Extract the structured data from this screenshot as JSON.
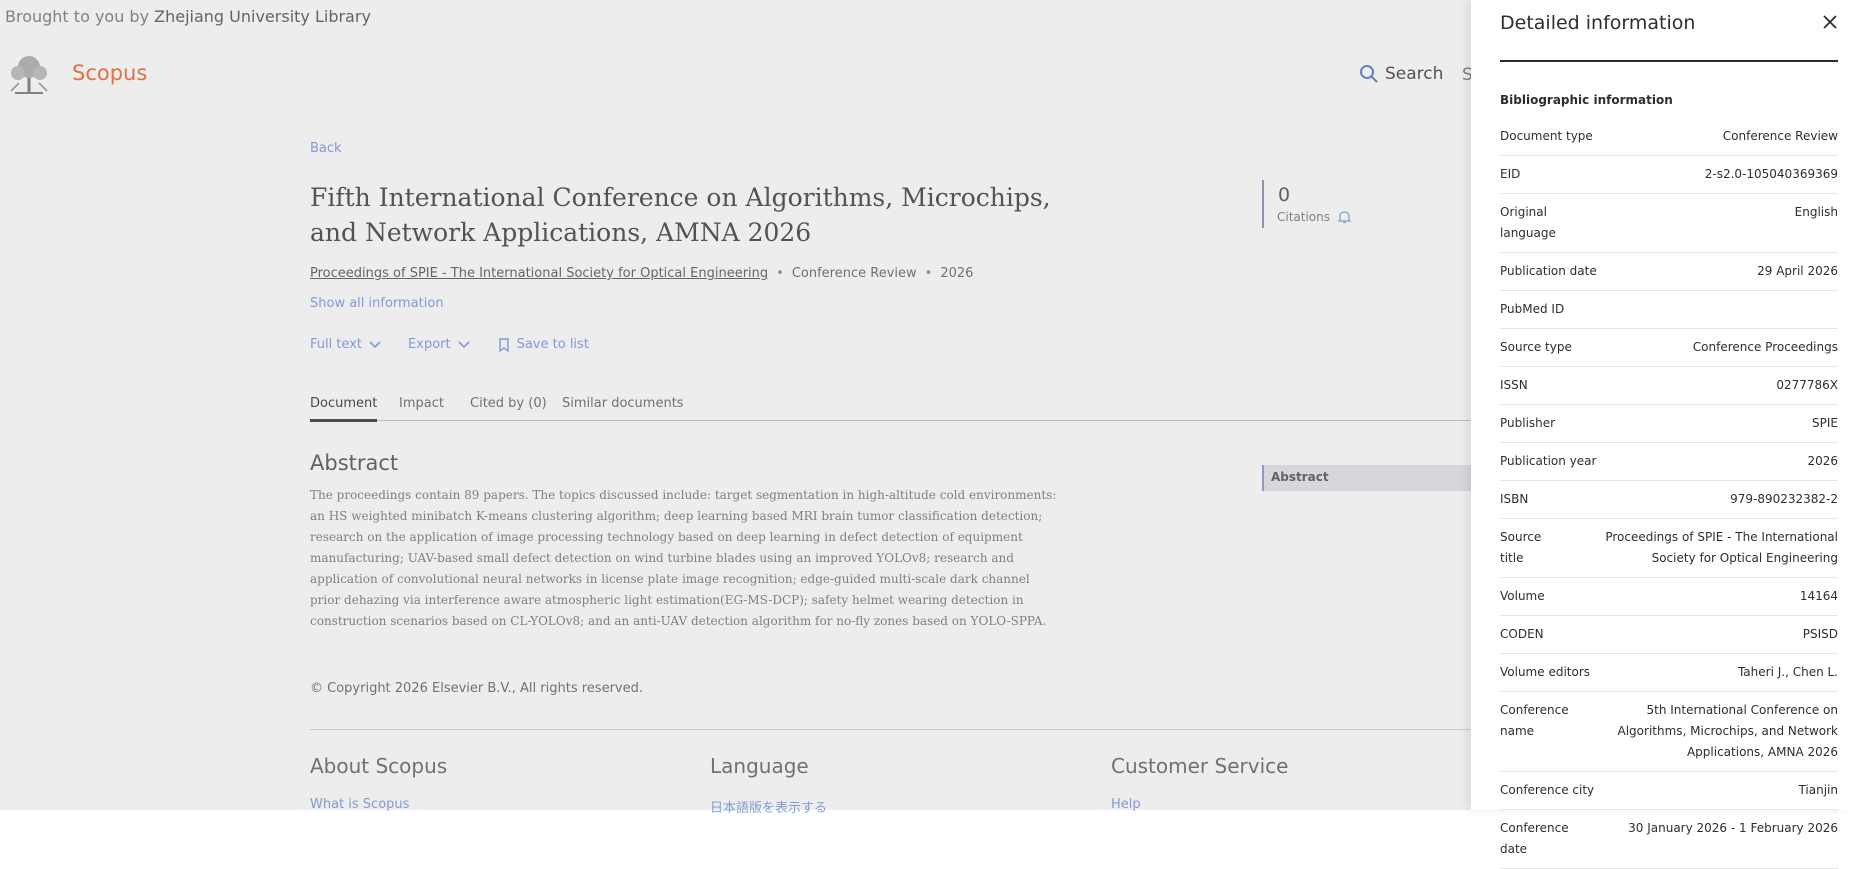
{
  "header": {
    "brought_prefix": "Brought to you by",
    "institution": "Zhejiang University Library",
    "brand": "Scopus",
    "search_label": "Search",
    "cut_label": "S"
  },
  "main": {
    "back": "Back",
    "title": "Fifth International Conference on Algorithms, Microchips, and Network Applications, AMNA 2026",
    "source": "Proceedings of SPIE - The International Society for Optical Engineering",
    "sep": "•",
    "doc_type": "Conference Review",
    "year": "2026",
    "show_all": "Show all information",
    "actions": {
      "full_text": "Full text",
      "export": "Export",
      "save": "Save to list"
    },
    "citations": {
      "count": "0",
      "label": "Citations"
    },
    "tabs": [
      "Document",
      "Impact",
      "Cited by (0)",
      "Similar documents"
    ],
    "abstract_heading": "Abstract",
    "abstract": "The proceedings contain 89 papers. The topics discussed include: target segmentation in high-altitude cold environments: an HS weighted minibatch K-means clustering algorithm; deep learning based MRI brain tumor classification detection; research on the application of image processing technology based on deep learning in defect detection of equipment manufacturing; UAV-based small defect detection on wind turbine blades using an improved YOLOv8; research and application of convolutional neural networks in license plate image recognition; edge-guided multi-scale dark channel prior dehazing via interference aware atmospheric light estimation(EG-MS-DCP); safety helmet wearing detection in construction scenarios based on CL-YOLOv8; and an anti-UAV detection algorithm for no-fly zones based on YOLO-SPPA.",
    "copyright": "© Copyright 2026 Elsevier B.V., All rights reserved.",
    "toc_label": "Abstract"
  },
  "footer": {
    "cols": [
      {
        "heading": "About Scopus",
        "link": "What is Scopus"
      },
      {
        "heading": "Language",
        "link": "日本語版を表示する"
      },
      {
        "heading": "Customer Service",
        "link": "Help"
      }
    ]
  },
  "panel": {
    "title": "Detailed information",
    "subtitle": "Bibliographic information",
    "rows": [
      {
        "k": "Document type",
        "v": "Conference Review"
      },
      {
        "k": "EID",
        "v": "2-s2.0-105040369369"
      },
      {
        "k": "Original language",
        "v": "English"
      },
      {
        "k": "Publication date",
        "v": "29 April 2026"
      },
      {
        "k": "PubMed ID",
        "v": ""
      },
      {
        "k": "Source type",
        "v": "Conference Proceedings"
      },
      {
        "k": "ISSN",
        "v": "0277786X"
      },
      {
        "k": "Publisher",
        "v": "SPIE"
      },
      {
        "k": "Publication year",
        "v": "2026"
      },
      {
        "k": "ISBN",
        "v": "979-890232382-2"
      },
      {
        "k": "Source title",
        "v": "Proceedings of SPIE - The International Society for Optical Engineering"
      },
      {
        "k": "Volume",
        "v": "14164"
      },
      {
        "k": "CODEN",
        "v": "PSISD"
      },
      {
        "k": "Volume editors",
        "v": "Taheri J., Chen L."
      },
      {
        "k": "Conference name",
        "v": "5th International Conference on Algorithms, Microchips, and Network Applications, AMNA 2026"
      },
      {
        "k": "Conference city",
        "v": "Tianjin"
      },
      {
        "k": "Conference date",
        "v": "30 January 2026 - 1 February 2026"
      }
    ]
  }
}
